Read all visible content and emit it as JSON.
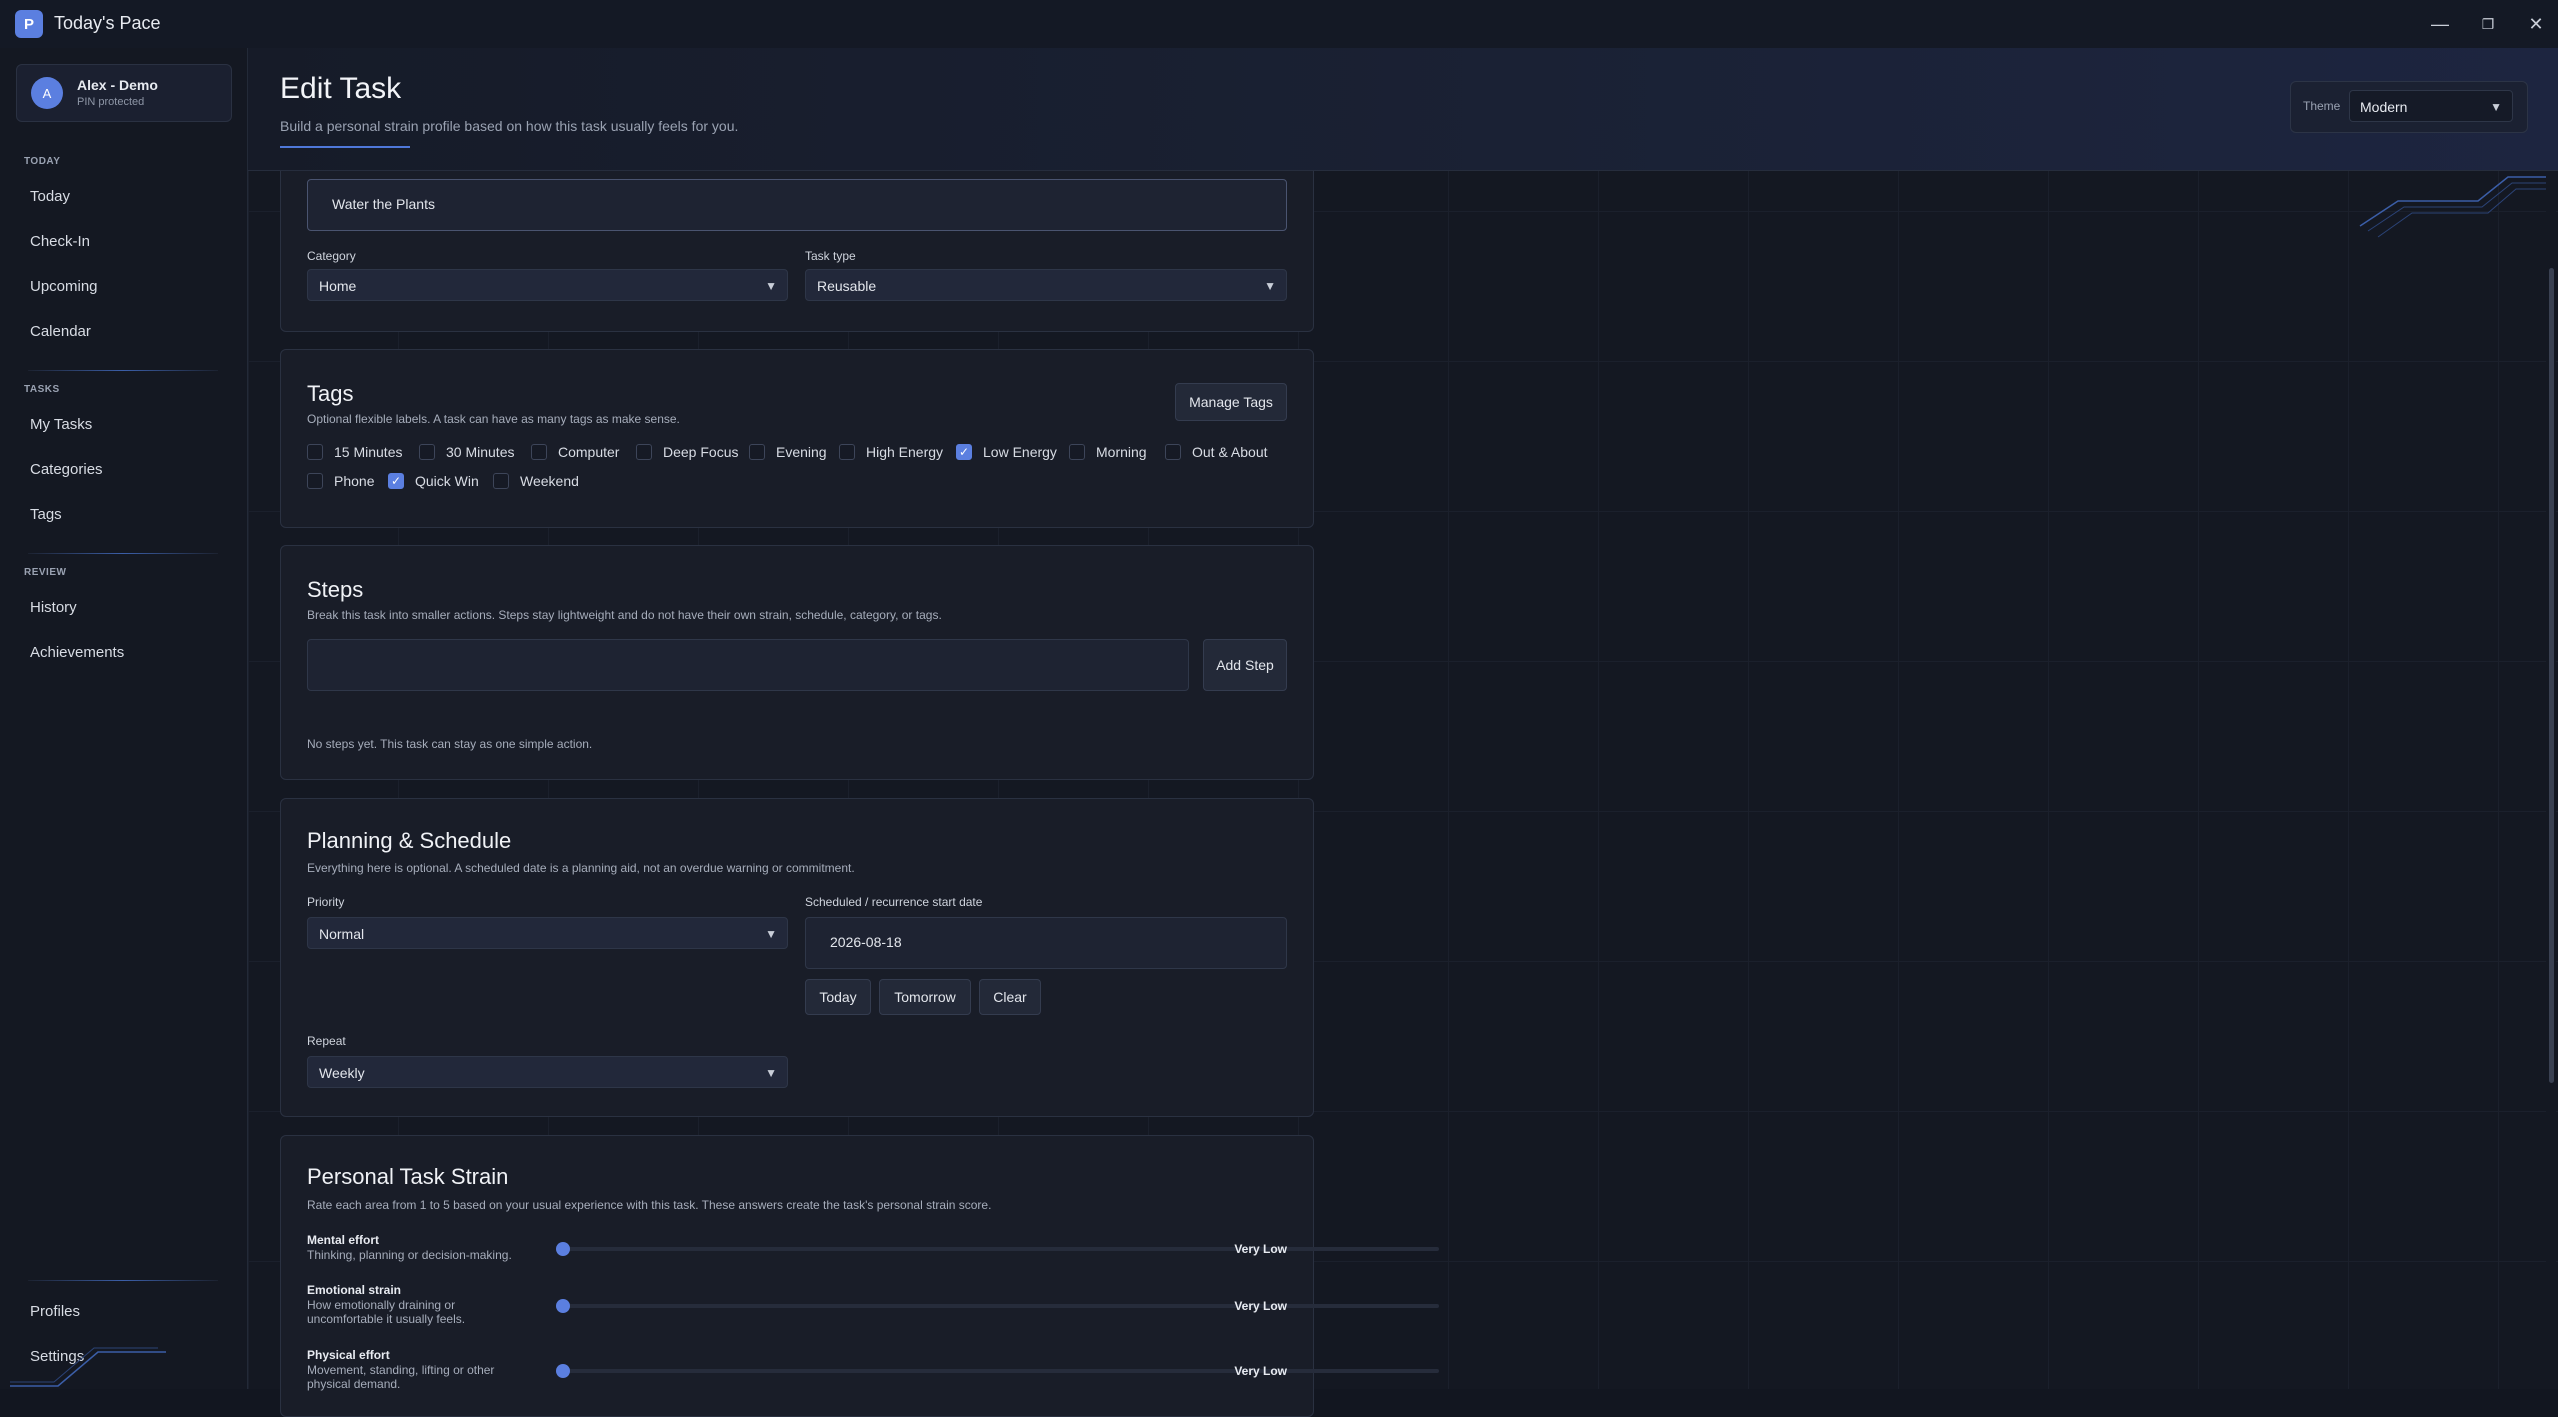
{
  "app": {
    "logo_letter": "P",
    "title": "Today's Pace"
  },
  "window_controls": {
    "minimize": "—",
    "maximize": "❐",
    "close": "✕"
  },
  "sidebar": {
    "profile": {
      "initial": "A",
      "name": "Alex - Demo",
      "subtitle": "PIN protected"
    },
    "sections": [
      {
        "label": "TODAY",
        "items": [
          "Today",
          "Check-In",
          "Upcoming",
          "Calendar"
        ]
      },
      {
        "label": "TASKS",
        "items": [
          "My Tasks",
          "Categories",
          "Tags"
        ]
      },
      {
        "label": "REVIEW",
        "items": [
          "History",
          "Achievements"
        ]
      }
    ],
    "bottom_items": [
      "Profiles",
      "Settings"
    ]
  },
  "header": {
    "title": "Edit Task",
    "subtitle": "Build a personal strain profile based on how this task usually feels for you.",
    "theme_label": "Theme",
    "theme_value": "Modern"
  },
  "basics": {
    "task_name": "Water the Plants",
    "category_label": "Category",
    "category_value": "Home",
    "task_type_label": "Task type",
    "task_type_value": "Reusable"
  },
  "tags": {
    "title": "Tags",
    "description": "Optional flexible labels. A task can have as many tags as make sense.",
    "manage_button": "Manage Tags",
    "items": [
      {
        "label": "15 Minutes",
        "checked": false
      },
      {
        "label": "30 Minutes",
        "checked": false
      },
      {
        "label": "Computer",
        "checked": false
      },
      {
        "label": "Deep Focus",
        "checked": false
      },
      {
        "label": "Evening",
        "checked": false
      },
      {
        "label": "High Energy",
        "checked": false
      },
      {
        "label": "Low Energy",
        "checked": true
      },
      {
        "label": "Morning",
        "checked": false
      },
      {
        "label": "Out & About",
        "checked": false
      },
      {
        "label": "Phone",
        "checked": false
      },
      {
        "label": "Quick Win",
        "checked": true
      },
      {
        "label": "Weekend",
        "checked": false
      }
    ]
  },
  "steps": {
    "title": "Steps",
    "description": "Break this task into smaller actions. Steps stay lightweight and do not have their own strain, schedule, category, or tags.",
    "input_value": "",
    "add_button": "Add Step",
    "empty_text": "No steps yet. This task can stay as one simple action."
  },
  "planning": {
    "title": "Planning & Schedule",
    "description": "Everything here is optional. A scheduled date is a planning aid, not an overdue warning or commitment.",
    "priority_label": "Priority",
    "priority_value": "Normal",
    "date_label": "Scheduled / recurrence start date",
    "date_value": "2026-08-18",
    "date_buttons": [
      "Today",
      "Tomorrow",
      "Clear"
    ],
    "repeat_label": "Repeat",
    "repeat_value": "Weekly"
  },
  "strain": {
    "title": "Personal Task Strain",
    "description": "Rate each area from 1 to 5 based on your usual experience with this task. These answers create the task's personal strain score.",
    "rows": [
      {
        "label": "Mental effort",
        "desc": "Thinking, planning or decision-making.",
        "level": 1,
        "value_text": "Very Low"
      },
      {
        "label": "Emotional strain",
        "desc": "How emotionally draining or uncomfortable it usually feels.",
        "level": 1,
        "value_text": "Very Low"
      },
      {
        "label": "Physical effort",
        "desc": "Movement, standing, lifting or other physical demand.",
        "level": 1,
        "value_text": "Very Low"
      }
    ]
  },
  "colors": {
    "accent": "#5b7fe0",
    "background": "#121620",
    "card": "#191d28"
  }
}
